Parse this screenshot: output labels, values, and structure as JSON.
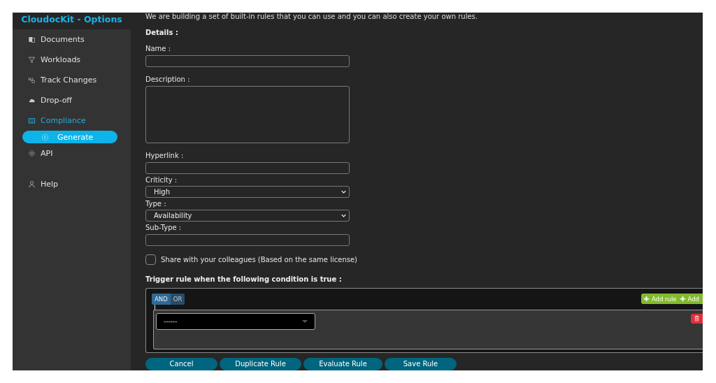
{
  "sidebar": {
    "title": "CloudocKit - Options",
    "items": [
      {
        "label": "Documents",
        "selected": false
      },
      {
        "label": "Workloads",
        "selected": false
      },
      {
        "label": "Track Changes",
        "selected": false
      },
      {
        "label": "Drop-off",
        "selected": false
      },
      {
        "label": "Compliance",
        "selected": true,
        "children": [
          {
            "label": "Generate",
            "selected": true
          }
        ]
      },
      {
        "label": "API",
        "selected": false
      },
      {
        "label": "Help",
        "selected": false
      }
    ]
  },
  "intro": "We are building a set of built-in rules that you can use and you can also create your own rules.",
  "details_heading": "Details :",
  "fields": [
    {
      "kind": "text",
      "label": "Name :"
    },
    {
      "kind": "textarea",
      "label": "Description :"
    },
    {
      "kind": "text",
      "label": "Hyperlink :"
    },
    {
      "kind": "select",
      "label": "Criticity :",
      "value": "High"
    },
    {
      "kind": "select",
      "label": "Type :",
      "value": "Availability"
    },
    {
      "kind": "text",
      "label": "Sub-Type :"
    }
  ],
  "share": {
    "label": "Share with your colleagues (Based on the same license)",
    "checked": false
  },
  "trigger_heading": "Trigger rule when the following condition is true :",
  "builder": {
    "conditions": [
      {
        "label": "AND",
        "selected": true
      },
      {
        "label": "OR",
        "selected": false
      }
    ],
    "add_buttons": [
      "Add rule",
      "Add"
    ],
    "rule": {
      "value": "------"
    }
  },
  "buttons": [
    "Cancel",
    "Duplicate Rule",
    "Evaluate Rule",
    "Save Rule"
  ]
}
